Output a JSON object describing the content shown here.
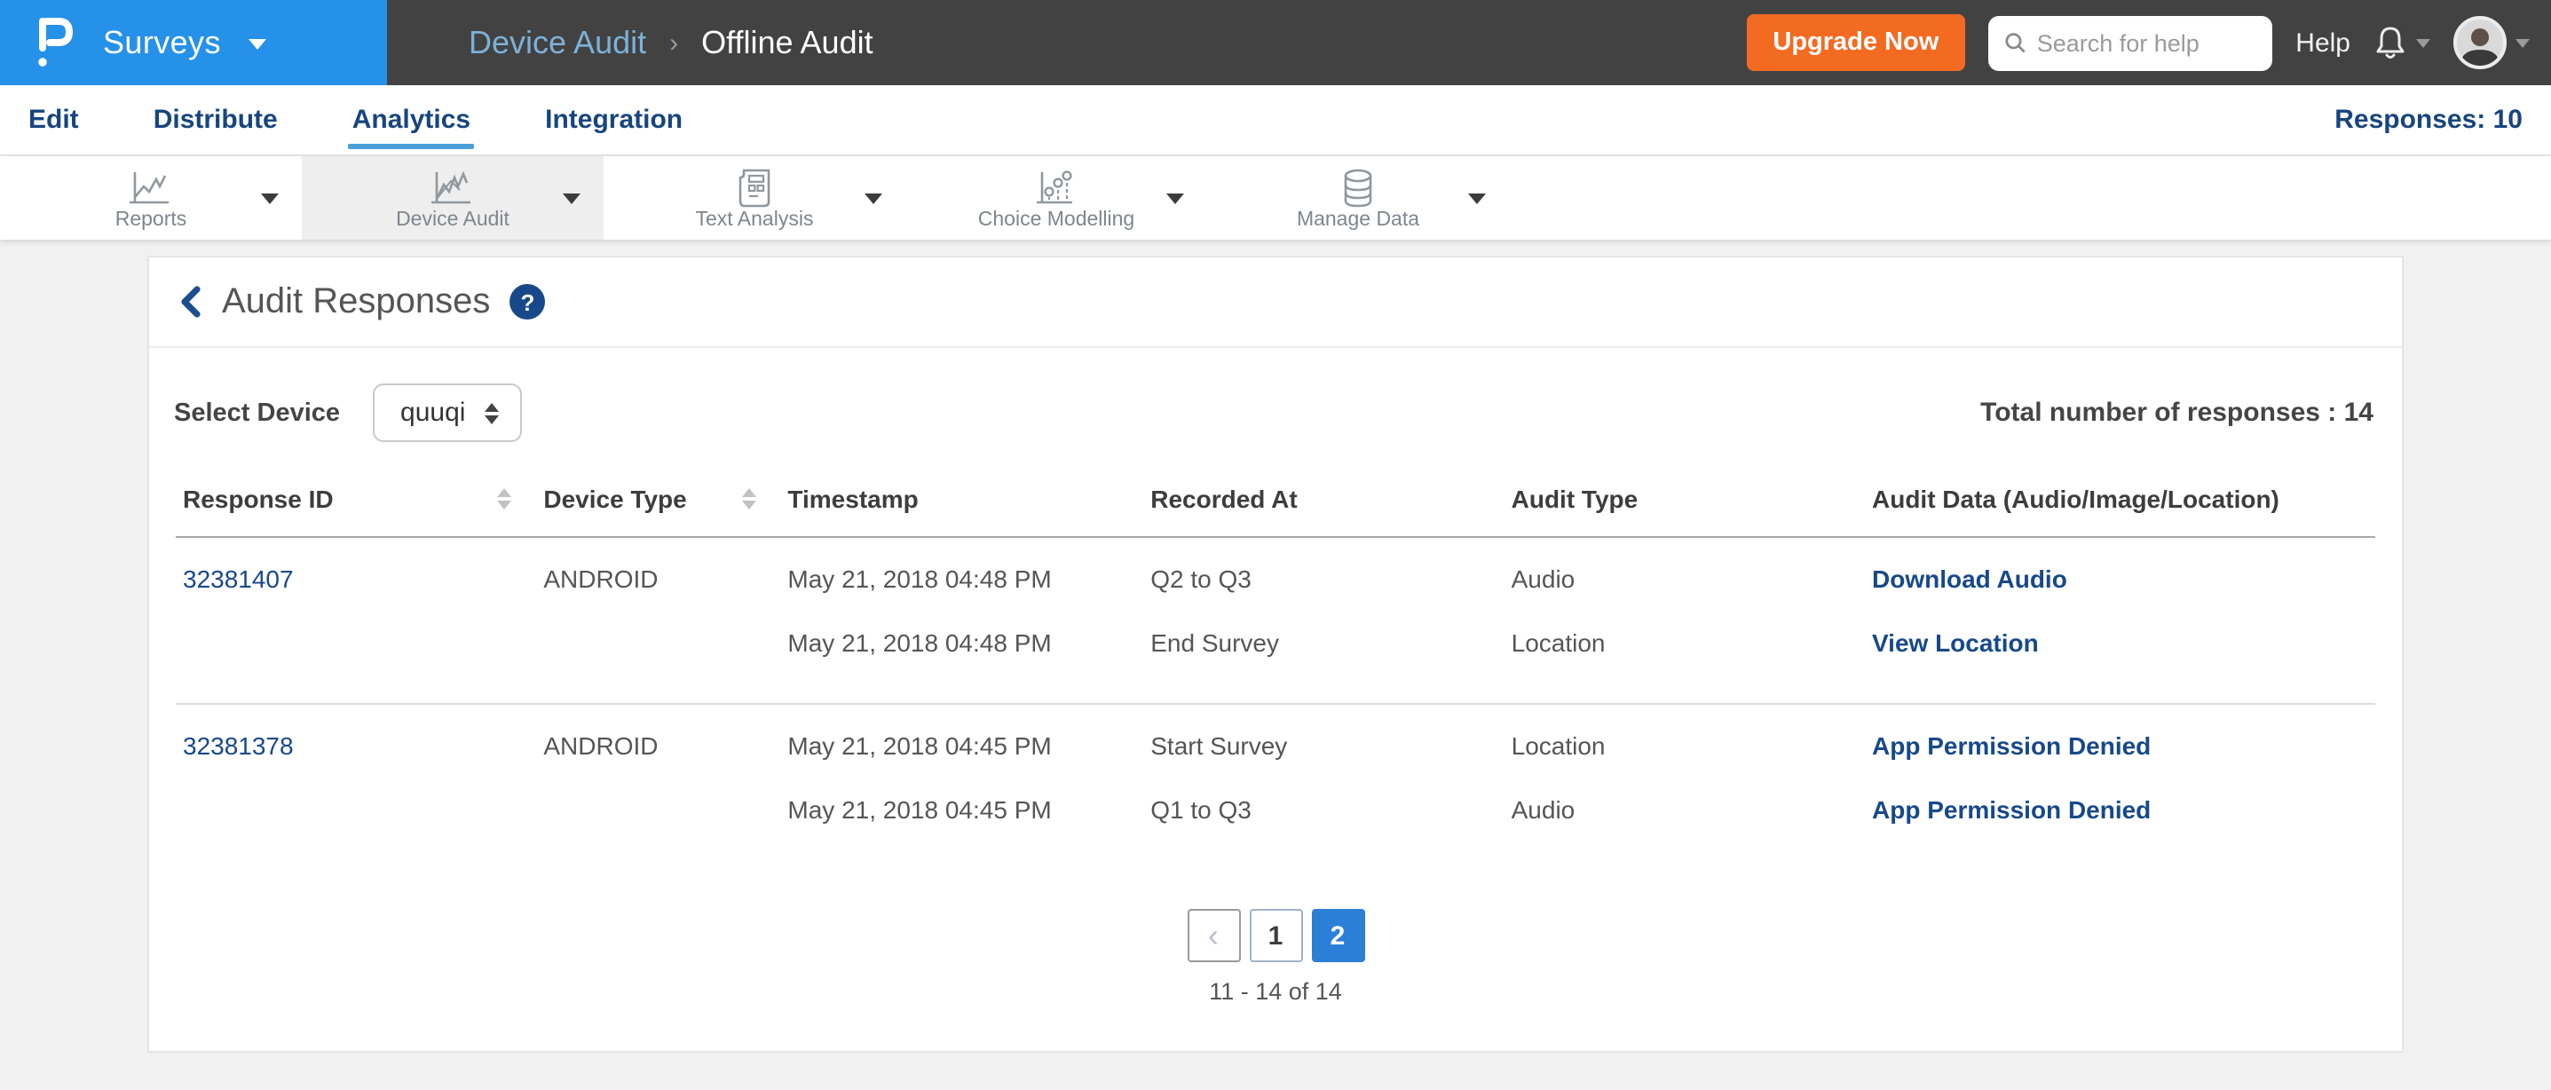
{
  "colors": {
    "brand_blue": "#2591e9",
    "header_dark": "#424242",
    "upgrade_orange": "#f36a21",
    "nav_navy": "#17457f",
    "link_navy": "#17498a",
    "active_page_blue": "#2b7fd6",
    "analytics_underline": "#4aa0d8",
    "page_background": "#f1f1f1"
  },
  "header": {
    "product_label": "Surveys",
    "breadcrumb": {
      "parent": "Device Audit",
      "separator": "›",
      "current": "Offline Audit"
    },
    "upgrade_label": "Upgrade Now",
    "search_placeholder": "Search for help",
    "help_label": "Help"
  },
  "nav": {
    "tabs": [
      {
        "label": "Edit"
      },
      {
        "label": "Distribute"
      },
      {
        "label": "Analytics",
        "active": true
      },
      {
        "label": "Integration"
      }
    ],
    "responses_label": "Responses: 10"
  },
  "toolbar": {
    "items": [
      {
        "label": "Reports",
        "icon": "line-chart",
        "selected": false
      },
      {
        "label": "Device Audit",
        "icon": "line-chart",
        "selected": true
      },
      {
        "label": "Text Analysis",
        "icon": "document",
        "selected": false
      },
      {
        "label": "Choice Modelling",
        "icon": "scatter-chart",
        "selected": false
      },
      {
        "label": "Manage Data",
        "icon": "database",
        "selected": false
      }
    ]
  },
  "content": {
    "title": "Audit Responses",
    "select_device_label": "Select Device",
    "device_value": "quuqi",
    "total_label": "Total number of responses : 14",
    "table": {
      "columns": [
        "Response ID",
        "Device Type",
        "Timestamp",
        "Recorded At",
        "Audit Type",
        "Audit Data (Audio/Image/Location)"
      ],
      "groups": [
        {
          "response_id": "32381407",
          "device_type": "ANDROID",
          "entries": [
            {
              "timestamp": "May 21, 2018 04:48 PM",
              "recorded_at": "Q2 to Q3",
              "audit_type": "Audio",
              "action": "Download Audio"
            },
            {
              "timestamp": "May 21, 2018 04:48 PM",
              "recorded_at": "End Survey",
              "audit_type": "Location",
              "action": "View Location"
            }
          ]
        },
        {
          "response_id": "32381378",
          "device_type": "ANDROID",
          "entries": [
            {
              "timestamp": "May 21, 2018 04:45 PM",
              "recorded_at": "Start Survey",
              "audit_type": "Location",
              "action": "App Permission Denied"
            },
            {
              "timestamp": "May 21, 2018 04:45 PM",
              "recorded_at": "Q1 to Q3",
              "audit_type": "Audio",
              "action": "App Permission Denied"
            }
          ]
        }
      ]
    },
    "pagination": {
      "prev": "‹",
      "pages": [
        "1",
        "2"
      ],
      "active_page": "2",
      "caption": "11 - 14 of 14"
    }
  }
}
